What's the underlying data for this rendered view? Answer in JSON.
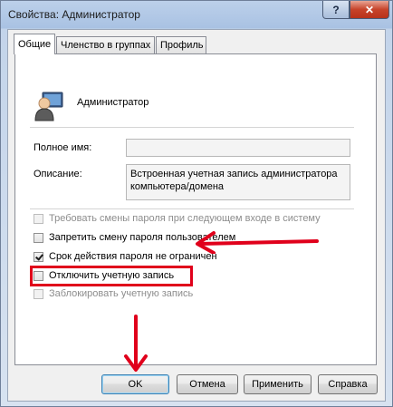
{
  "window": {
    "title": "Свойства: Администратор",
    "help_label": "?",
    "close_label": "✕"
  },
  "tabs": [
    {
      "label": "Общие",
      "active": true
    },
    {
      "label": "Членство в группах",
      "active": false
    },
    {
      "label": "Профиль",
      "active": false
    }
  ],
  "user": {
    "name": "Администратор",
    "icon": "user-icon"
  },
  "fields": {
    "fullname_label": "Полное имя:",
    "fullname_value": "",
    "description_label": "Описание:",
    "description_value": "Встроенная учетная запись администратора компьютера/домена"
  },
  "checkboxes": [
    {
      "label": "Требовать смены пароля при следующем входе в систему",
      "checked": false,
      "enabled": false
    },
    {
      "label": "Запретить смену пароля пользователем",
      "checked": false,
      "enabled": true
    },
    {
      "label": "Срок действия пароля не ограничен",
      "checked": true,
      "enabled": true
    },
    {
      "label": "Отключить учетную запись",
      "checked": false,
      "enabled": true
    },
    {
      "label": "Заблокировать учетную запись",
      "checked": false,
      "enabled": false
    }
  ],
  "buttons": {
    "ok": "OK",
    "cancel": "Отмена",
    "apply": "Применить",
    "help": "Справка"
  },
  "colors": {
    "annotation": "#e0001b"
  }
}
